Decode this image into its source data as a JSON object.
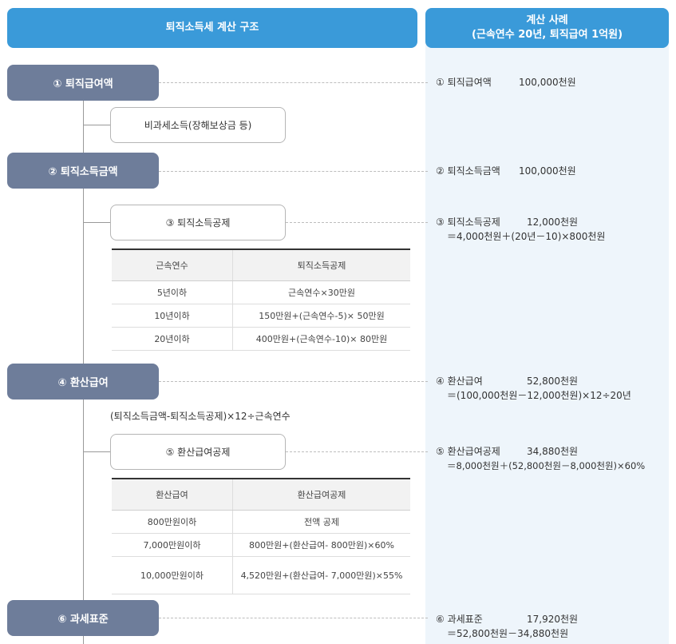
{
  "header": {
    "left_title": "퇴직소득세 계산 구조",
    "right_title": "계산 사례",
    "right_subtitle": "(근속연수 20년, 퇴직급여 1억원)"
  },
  "structure": {
    "step1": "① 퇴직급여액",
    "nontax": "비과세소득(장해보상금 등)",
    "step2": "② 퇴직소득금액",
    "step3": "③ 퇴직소득공제",
    "table1": {
      "headers": [
        "근속연수",
        "퇴직소득공제"
      ],
      "rows": [
        [
          "5년이하",
          "근속연수×30만원"
        ],
        [
          "10년이하",
          "150만원+(근속연수-5)× 50만원"
        ],
        [
          "20년이하",
          "400만원+(근속연수-10)× 80만원"
        ]
      ]
    },
    "step4": "④ 환산급여",
    "formula4": "(퇴직소득금액-퇴직소득공제)×12÷근속연수",
    "step5": "⑤ 환산급여공제",
    "table2": {
      "headers": [
        "환산급여",
        "환산급여공제"
      ],
      "rows": [
        [
          "800만원이하",
          "전액 공제"
        ],
        [
          "7,000만원이하",
          "800만원+(환산급여- 800만원)×60%"
        ],
        [
          "10,000만원이하",
          "4,520만원+(환산급여- 7,000만원)×55%"
        ]
      ]
    },
    "step6": "⑥ 과세표준"
  },
  "example": {
    "c1": {
      "label": "① 퇴직급여액",
      "amount": "100,000천원"
    },
    "c2": {
      "label": "② 퇴직소득금액",
      "amount": "100,000천원"
    },
    "c3": {
      "label": "③ 퇴직소득공제",
      "amount": "12,000천원",
      "formula": "＝4,000천원＋(20년－10)×800천원"
    },
    "c4": {
      "label": "④ 환산급여",
      "amount": "52,800천원",
      "formula": "＝(100,000천원－12,000천원)×12÷20년"
    },
    "c5": {
      "label": "⑤ 환산급여공제",
      "amount": "34,880천원",
      "formula": "＝8,000천원＋(52,800천원－8,000천원)×60%"
    },
    "c6": {
      "label": "⑥ 과세표준",
      "amount": "17,920천원",
      "formula": "＝52,800천원－34,880천원"
    }
  }
}
